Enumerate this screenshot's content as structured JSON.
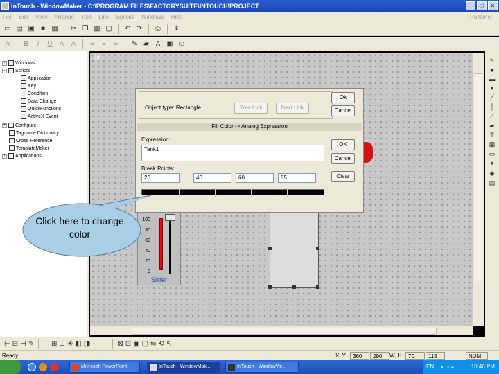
{
  "window": {
    "title": "InTouch - WindowMaker - C:\\PROGRAM FILES\\FACTORYSUITE\\INTOUCH\\PROJECT",
    "min": "_",
    "max": "□",
    "close": "×"
  },
  "menu": {
    "items": [
      "File",
      "Edit",
      "View",
      "Arrange",
      "Text",
      "Line",
      "Special",
      "Windows",
      "Help"
    ],
    "runtime": "Runtime!"
  },
  "toolbar2": {
    "bold": "B",
    "italic": "I",
    "underline": "U"
  },
  "tree": {
    "items": [
      {
        "label": "Windows",
        "level": 0,
        "expander": "+"
      },
      {
        "label": "Scripts",
        "level": 0,
        "expander": "-"
      },
      {
        "label": "Application",
        "level": 1
      },
      {
        "label": "Key",
        "level": 1
      },
      {
        "label": "Condition",
        "level": 1
      },
      {
        "label": "Data Change",
        "level": 1
      },
      {
        "label": "QuickFunctions",
        "level": 1
      },
      {
        "label": "ActiveX Event",
        "level": 1
      },
      {
        "label": "Configure",
        "level": 0,
        "expander": "+"
      },
      {
        "label": "Tagname Dictionary",
        "level": 0
      },
      {
        "label": "Cross Reference",
        "level": 0
      },
      {
        "label": "TemplateMaker",
        "level": 0
      },
      {
        "label": "Applications",
        "level": 0,
        "expander": "+"
      }
    ]
  },
  "canvas": {
    "window_label": "ain"
  },
  "dialog": {
    "object_type": "Object type:  Rectangle",
    "prev_link": "Prev Link",
    "next_link": "Next Link",
    "ok_top": "Ok",
    "cancel_top": "Cancel",
    "subtitle": "Fill Color -> Analog Expression",
    "expression_label": "Expression:",
    "expression_value": "Tank1",
    "ok": "OK",
    "cancel": "Cancel",
    "breakpoints_label": "Break Points:",
    "breakpoints": [
      "20",
      "40",
      "60",
      "85"
    ],
    "clear": "Clear"
  },
  "slider": {
    "scale": [
      "100",
      "80",
      "60",
      "40",
      "20",
      "0"
    ],
    "label": "Slider",
    "partial_label": "ain"
  },
  "callout": {
    "text": "Click here to change color"
  },
  "status": {
    "ready": "Ready",
    "xy_label": "X, Y",
    "x": "360",
    "y": "290",
    "wh_label": "W, H",
    "w": "70",
    "h": "115",
    "num": "NUM"
  },
  "taskbar": {
    "tasks": [
      "Microsoft PowerPoint",
      "InTouch - WindowMak...",
      "InTouch - WindowVie..."
    ],
    "lang": "EN",
    "clock": "10:46 PM"
  },
  "colors": {
    "titlebar": "#1a46b8",
    "chrome": "#ece9d8",
    "canvas": "#c8c8c8",
    "callout_fill": "#a8cfe6",
    "slider_red": "#d81010",
    "slider_label": "#1a3fc0"
  }
}
